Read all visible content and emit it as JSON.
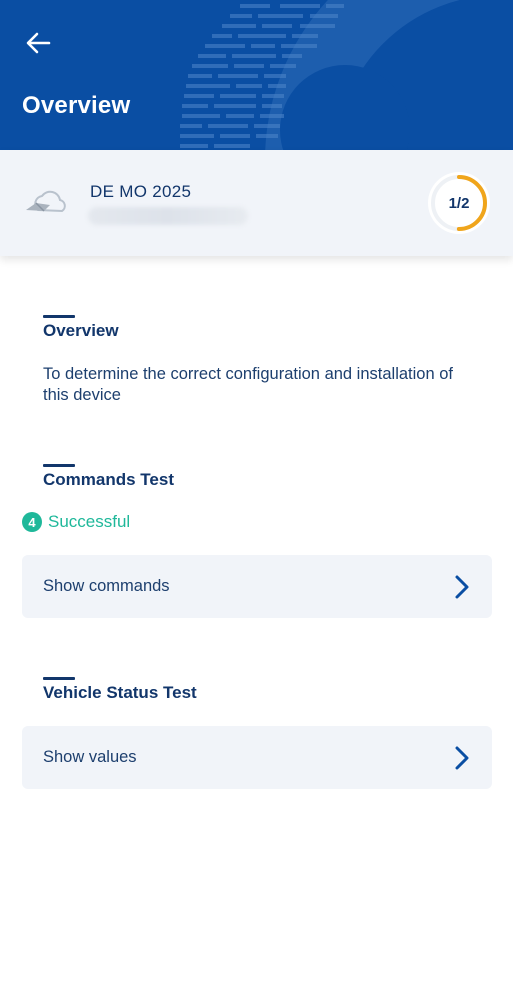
{
  "header": {
    "title": "Overview",
    "back_icon": "arrow-left-icon",
    "background_color": "#0a4ea3"
  },
  "device": {
    "name": "DE MO 2025",
    "icon": "vehicle-cloud-icon",
    "progress_text": "1/2",
    "progress_fraction": 0.5,
    "progress_color": "#f0a51b"
  },
  "sections": {
    "overview": {
      "title": "Overview",
      "description": "To determine the correct configuration and installation of this device"
    },
    "commands": {
      "title": "Commands Test",
      "status_count": "4",
      "status_text": "Successful",
      "status_color": "#1fb89a",
      "button_label": "Show commands"
    },
    "vehicle": {
      "title": "Vehicle Status Test",
      "button_label": "Show values"
    }
  },
  "icons": {
    "chevron": "chevron-right-icon"
  }
}
